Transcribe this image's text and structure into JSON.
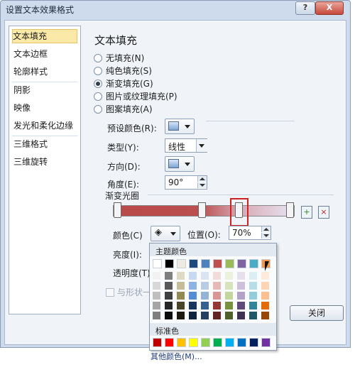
{
  "window": {
    "title": "设置文本效果格式",
    "help_label": "?",
    "close_label": "X"
  },
  "nav": {
    "items": [
      {
        "label": "文本填充",
        "selected": true
      },
      {
        "label": "文本边框"
      },
      {
        "label": "轮廓样式"
      },
      {
        "label": "阴影"
      },
      {
        "label": "映像"
      },
      {
        "label": "发光和柔化边缘"
      },
      {
        "label": "三维格式"
      },
      {
        "label": "三维旋转"
      }
    ]
  },
  "panel": {
    "heading": "文本填充",
    "fill_options": [
      {
        "label": "无填充(N)",
        "checked": false
      },
      {
        "label": "纯色填充(S)",
        "checked": false
      },
      {
        "label": "渐变填充(G)",
        "checked": true
      },
      {
        "label": "图片或纹理填充(P)",
        "checked": false
      },
      {
        "label": "图案填充(A)",
        "checked": false
      }
    ],
    "preset_label": "预设颜色(R):",
    "type_label": "类型(Y):",
    "type_value": "线性",
    "direction_label": "方向(D):",
    "angle_label": "角度(E):",
    "angle_value": "90°",
    "stops_label": "渐变光圈",
    "color_label": "颜色(C)",
    "position_label": "位置(O):",
    "position_value": "70%",
    "brightness_label": "亮度(I):",
    "transparency_label": "透明度(T):",
    "rotate_label": "与形状一",
    "close_button": "关闭"
  },
  "palette": {
    "theme_title": "主题颜色",
    "standard_title": "标准色",
    "other_label": "其他颜色(M)...",
    "theme_top": [
      "#ffffff",
      "#000000",
      "#eeece1",
      "#1f497d",
      "#4f81bd",
      "#c0504d",
      "#9bbb59",
      "#8064a2",
      "#4bacc6",
      "#f79646"
    ],
    "theme_shades": [
      [
        "#f2f2f2",
        "#7f7f7f",
        "#ddd9c3",
        "#c6d9f0",
        "#dbe5f1",
        "#f2dcdb",
        "#ebf1dd",
        "#e5e0ec",
        "#dbeef3",
        "#fdeada"
      ],
      [
        "#d8d8d8",
        "#595959",
        "#c4bd97",
        "#8db3e2",
        "#b8cce4",
        "#e5b9b7",
        "#d7e3bc",
        "#ccc1d9",
        "#b7dde8",
        "#fbd5b5"
      ],
      [
        "#bfbfbf",
        "#3f3f3f",
        "#938953",
        "#548dd4",
        "#95b3d7",
        "#d99694",
        "#c3d69b",
        "#b2a2c7",
        "#92cddc",
        "#fac08f"
      ],
      [
        "#a5a5a5",
        "#262626",
        "#494429",
        "#17365d",
        "#366092",
        "#953734",
        "#76923c",
        "#5f497a",
        "#31859b",
        "#e36c09"
      ],
      [
        "#7f7f7f",
        "#0c0c0c",
        "#1d1b10",
        "#0f243e",
        "#244061",
        "#632423",
        "#4f6128",
        "#3f3151",
        "#205867",
        "#974806"
      ]
    ],
    "standard": [
      "#c00000",
      "#ff0000",
      "#ffc000",
      "#ffff00",
      "#92d050",
      "#00b050",
      "#00b0f0",
      "#0070c0",
      "#002060",
      "#7030a0"
    ]
  },
  "icons": {
    "cursor": "arrow-cursor-icon",
    "add_stop": "add-stop-icon",
    "remove_stop": "remove-stop-icon",
    "paint_bucket": "paint-bucket-icon"
  }
}
